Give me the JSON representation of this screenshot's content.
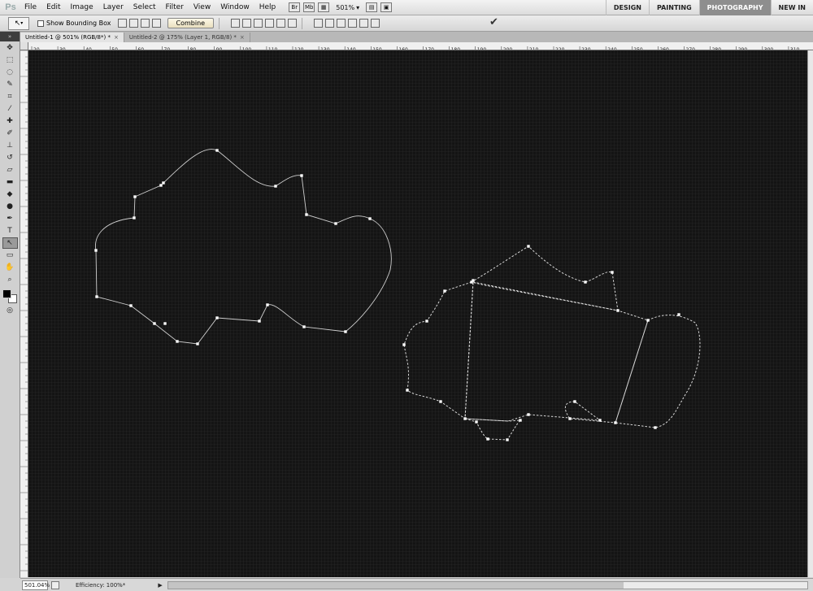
{
  "app": {
    "logo": "Ps"
  },
  "menu": [
    "File",
    "Edit",
    "Image",
    "Layer",
    "Select",
    "Filter",
    "View",
    "Window",
    "Help"
  ],
  "menubar_tools": {
    "zoom": "501%"
  },
  "workspaces": [
    {
      "label": "DESIGN",
      "active": false
    },
    {
      "label": "PAINTING",
      "active": false
    },
    {
      "label": "PHOTOGRAPHY",
      "active": true
    },
    {
      "label": "NEW IN",
      "active": false
    }
  ],
  "options": {
    "show_bounding_box_label": "Show Bounding Box",
    "combine_label": "Combine"
  },
  "tabs": [
    {
      "label": "Untitled-1 @ 501% (RGB/8*) *",
      "active": true
    },
    {
      "label": "Untitled-2 @ 175% (Layer 1, RGB/8) *",
      "active": false
    }
  ],
  "ruler_labels": [
    "20",
    "30",
    "40",
    "50",
    "60",
    "70",
    "80",
    "90",
    "100",
    "110",
    "120",
    "130",
    "140",
    "150",
    "160",
    "170",
    "180",
    "190",
    "200",
    "210",
    "220",
    "230",
    "240",
    "250",
    "260",
    "270",
    "280",
    "290",
    "300",
    "310"
  ],
  "status": {
    "zoom": "501.04%",
    "info": "Efficiency: 100%*"
  },
  "colors": {
    "canvas_bg": "#141414",
    "grid_line": "#2f2f2f",
    "path_stroke": "#d0d0d0",
    "anchor_fill": "#ffffff"
  },
  "tools": [
    "move-icon",
    "marquee-icon",
    "lasso-icon",
    "quick-select-icon",
    "crop-icon",
    "eyedropper-icon",
    "healing-icon",
    "brush-icon",
    "stamp-icon",
    "history-brush-icon",
    "eraser-icon",
    "gradient-icon",
    "blur-icon",
    "dodge-icon",
    "pen-icon",
    "type-icon",
    "path-select-icon",
    "shape-icon",
    "hand-icon",
    "zoom-icon"
  ]
}
